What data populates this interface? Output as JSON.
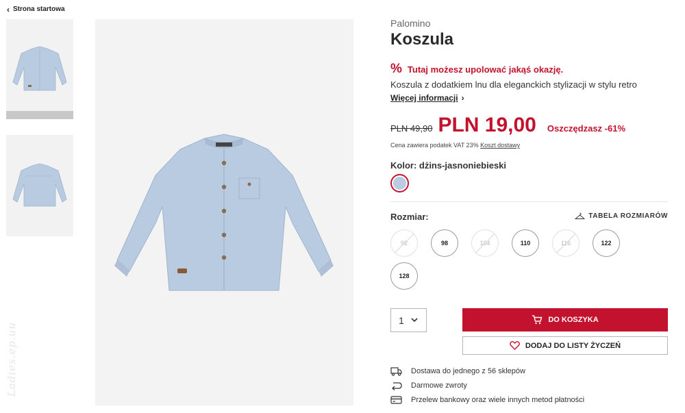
{
  "breadcrumb": {
    "label": "Strona startowa"
  },
  "product": {
    "brand": "Palomino",
    "title": "Koszula",
    "promo": "Tutaj możesz upolować jakąś okazję.",
    "description": "Koszula z dodatkiem lnu dla eleganckich stylizacji w stylu retro",
    "more_info": "Więcej informacji",
    "old_price": "PLN 49,90",
    "price": "PLN 19,00",
    "savings": "Oszczędzasz -61%",
    "vat_note": "Cena zawiera podatek VAT 23%",
    "shipping_link": "Koszt dostawy",
    "color_label": "Kolor: dżins-jasnoniebieski",
    "swatch_color": "#b9cbe0",
    "size_label": "Rozmiar:",
    "size_table_label": "TABELA ROZMIARÓW",
    "sizes": [
      {
        "label": "92",
        "available": false
      },
      {
        "label": "98",
        "available": true
      },
      {
        "label": "104",
        "available": false
      },
      {
        "label": "110",
        "available": true
      },
      {
        "label": "116",
        "available": false
      },
      {
        "label": "122",
        "available": true
      },
      {
        "label": "128",
        "available": true
      }
    ],
    "quantity": "1",
    "add_to_cart": "DO KOSZYKA",
    "add_to_wishlist": "DODAJ DO LISTY ŻYCZEŃ"
  },
  "benefits": [
    {
      "icon": "delivery-truck-icon",
      "text": "Dostawa do jednego z 56 sklepów"
    },
    {
      "icon": "return-arrow-icon",
      "text": "Darmowe zwroty"
    },
    {
      "icon": "credit-card-icon",
      "text": "Przelew bankowy oraz wiele innych metod płatności"
    }
  ],
  "watermark": "Ladies.ep.uu",
  "colors": {
    "accent": "#c3122d",
    "shirt": "#b9cbe0"
  }
}
